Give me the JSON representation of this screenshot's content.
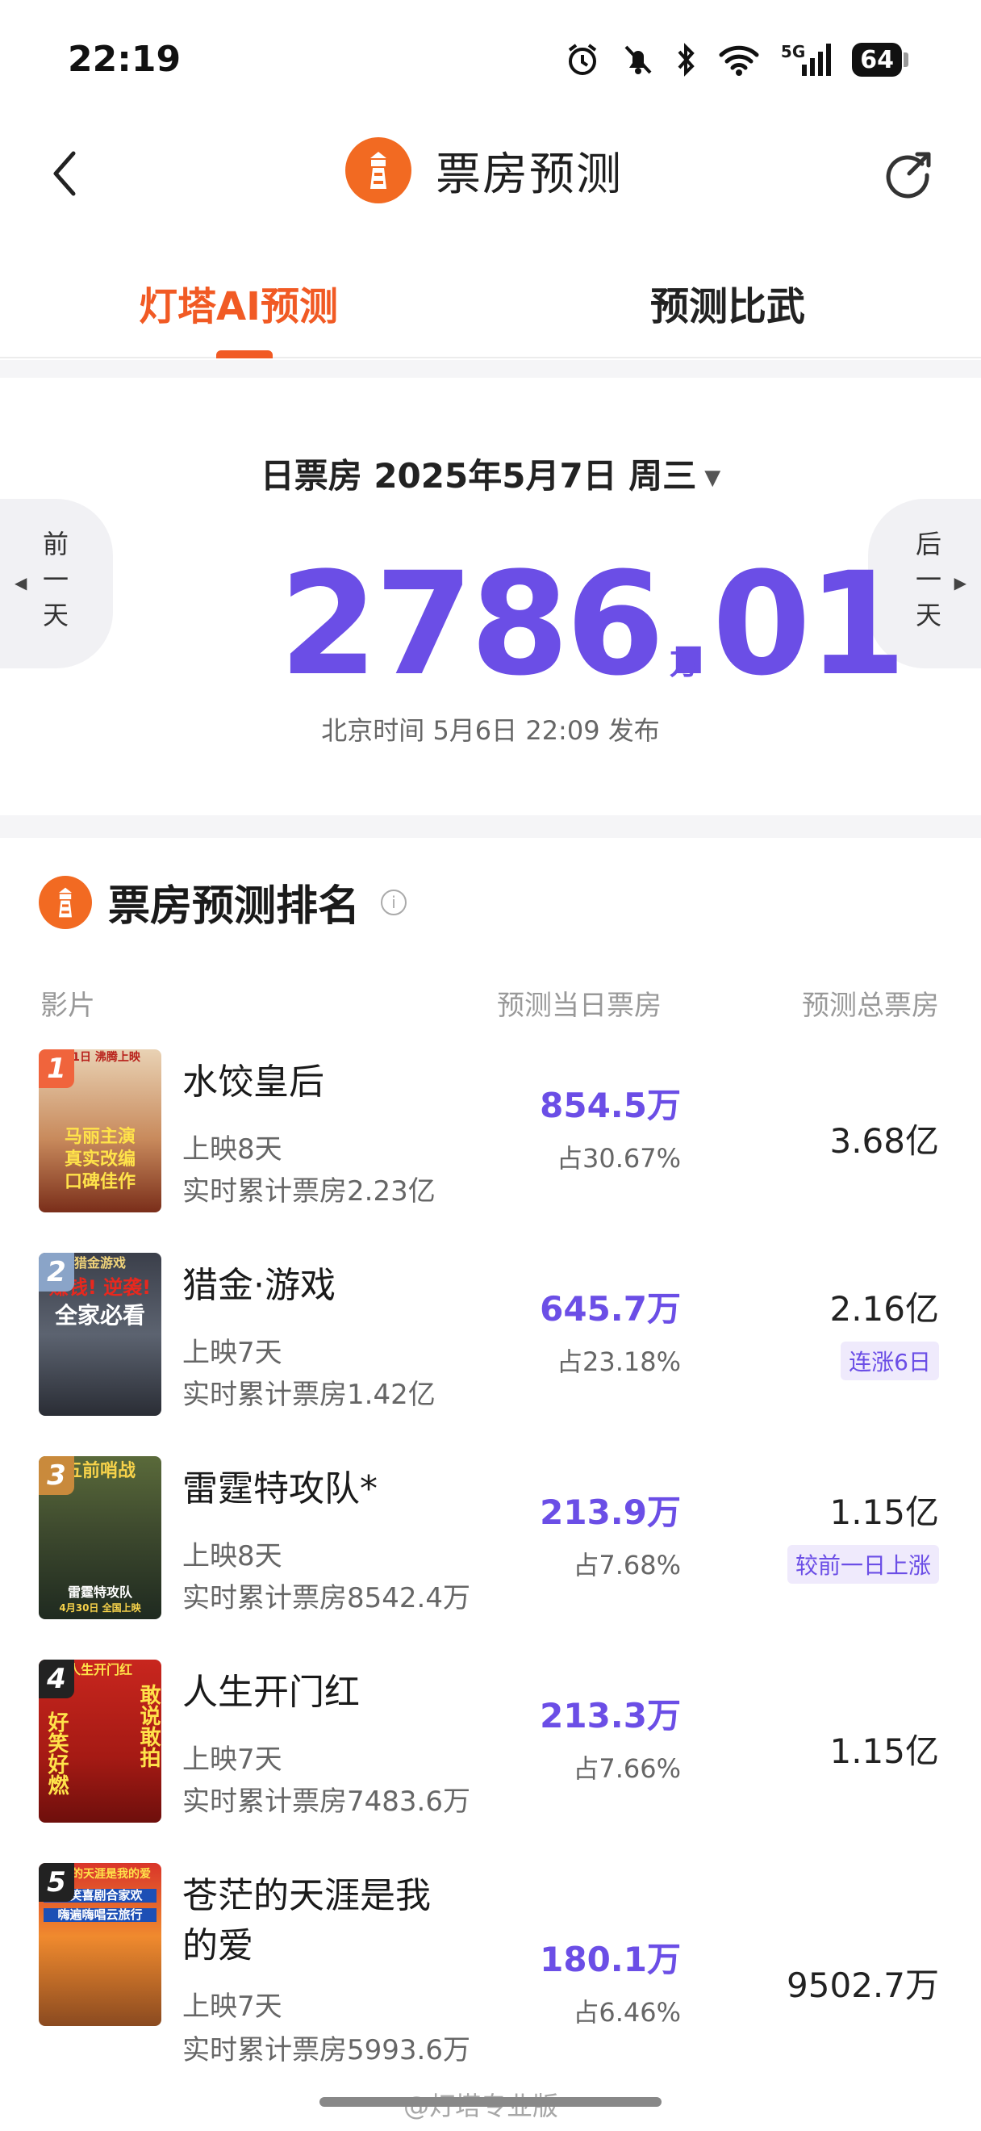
{
  "status_bar": {
    "time": "22:19",
    "network": "5G",
    "battery": "64",
    "icons": [
      "alarm-icon",
      "mute-icon",
      "bluetooth-icon",
      "wifi-icon",
      "signal-icon",
      "battery-icon"
    ]
  },
  "nav": {
    "title": "票房预测",
    "back_icon": "chevron-left-icon",
    "refresh_icon": "share-refresh-icon",
    "accent": "#f26a22"
  },
  "tabs": [
    {
      "label": "灯塔AI预测",
      "active": true
    },
    {
      "label": "预测比武",
      "active": false
    }
  ],
  "summary": {
    "date_label": "日票房 2025年5月7日 周三",
    "dropdown_glyph": "▼",
    "prev_label": "前一天",
    "next_label": "后一天",
    "prev_arrow": "◀",
    "next_arrow": "▶",
    "box_office": "2786.01",
    "unit": "万",
    "publish_note": "北京时间 5月6日 22:09 发布",
    "number_color": "#6b4ee6"
  },
  "ranking": {
    "title": "票房预测排名",
    "info_glyph": "i",
    "columns": {
      "film": "影片",
      "day": "预测当日票房",
      "total": "预测总票房"
    },
    "movies": [
      {
        "rank": "1",
        "title": "水饺皇后",
        "days": "上映8天",
        "cumulative": "实时累计票房2.23亿",
        "day_box": "854.5万",
        "share": "占30.67%",
        "total": "3.68亿",
        "tag": "",
        "poster_lines": [
          "马丽主演",
          "真实改编",
          "口碑佳作"
        ],
        "poster_top": "5.1日 沸腾上映",
        "badge_color": "#f0643c"
      },
      {
        "rank": "2",
        "title": "猎金·游戏",
        "days": "上映7天",
        "cumulative": "实时累计票房1.42亿",
        "day_box": "645.7万",
        "share": "占23.18%",
        "total": "2.16亿",
        "tag": "连涨6日",
        "poster_lines": [
          "赚钱! 逆袭!",
          "全家必看"
        ],
        "poster_top": "猎金游戏",
        "badge_color": "#8aa4c8"
      },
      {
        "rank": "3",
        "title": "雷霆特攻队*",
        "days": "上映8天",
        "cumulative": "实时累计票房8542.4万",
        "day_box": "213.9万",
        "share": "占7.68%",
        "total": "1.15亿",
        "tag": "较前一日上涨",
        "poster_lines": [
          "五前哨战",
          "雷霆特攻队"
        ],
        "poster_top": "4月30日 全国上映",
        "badge_color": "#c98a3c"
      },
      {
        "rank": "4",
        "title": "人生开门红",
        "days": "上映7天",
        "cumulative": "实时累计票房7483.6万",
        "day_box": "213.3万",
        "share": "占7.66%",
        "total": "1.15亿",
        "tag": "",
        "poster_lines": [
          "好笑好燃",
          "敢说敢拍"
        ],
        "poster_top": "人生开门红",
        "badge_color": "#222222"
      },
      {
        "rank": "5",
        "title": "苍茫的天涯是我的爱",
        "days": "上映7天",
        "cumulative": "实时累计票房5993.6万",
        "day_box": "180.1万",
        "share": "占6.46%",
        "total": "9502.7万",
        "tag": "",
        "poster_lines": [
          "爆笑喜剧合家欢",
          "嗨遍嗨唱云旅行"
        ],
        "poster_top": "苍茫的天涯是我的爱",
        "badge_color": "#222222"
      }
    ]
  },
  "watermark": "@灯塔专业版"
}
